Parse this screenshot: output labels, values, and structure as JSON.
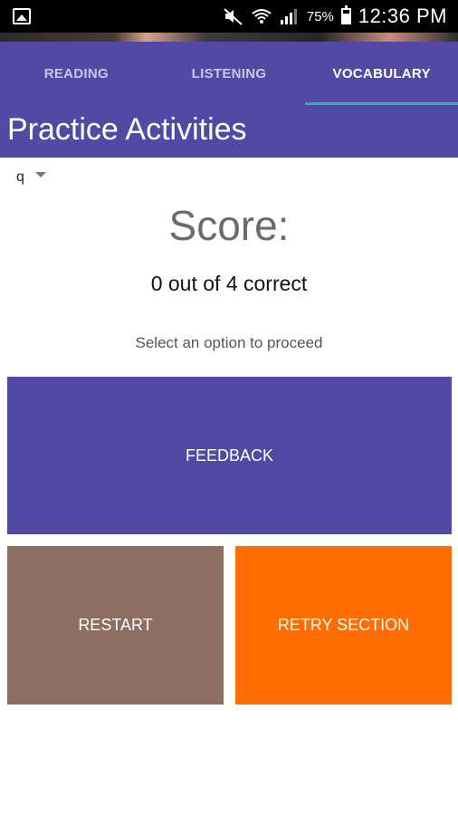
{
  "status_bar": {
    "icons": [
      "gallery-icon",
      "mute-icon",
      "wifi-icon",
      "signal-icon",
      "battery-icon"
    ],
    "battery_percent": "75%",
    "time": "12:36 PM"
  },
  "tabs": [
    {
      "label": "READING",
      "active": false
    },
    {
      "label": "LISTENING",
      "active": false
    },
    {
      "label": "VOCABULARY",
      "active": true
    }
  ],
  "header": {
    "title": "Practice Activities"
  },
  "selector": {
    "value": "q",
    "icon": "chevron-down-icon"
  },
  "score": {
    "title": "Score:",
    "value": "0 out of 4 correct",
    "prompt": "Select an option to proceed"
  },
  "actions": {
    "feedback_label": "FEEDBACK",
    "restart_label": "RESTART",
    "retry_label": "RETRY SECTION"
  },
  "colors": {
    "primary": "#5249a4",
    "tab_indicator": "#2db59a",
    "restart": "#8d6e63",
    "retry": "#ff6d00"
  }
}
